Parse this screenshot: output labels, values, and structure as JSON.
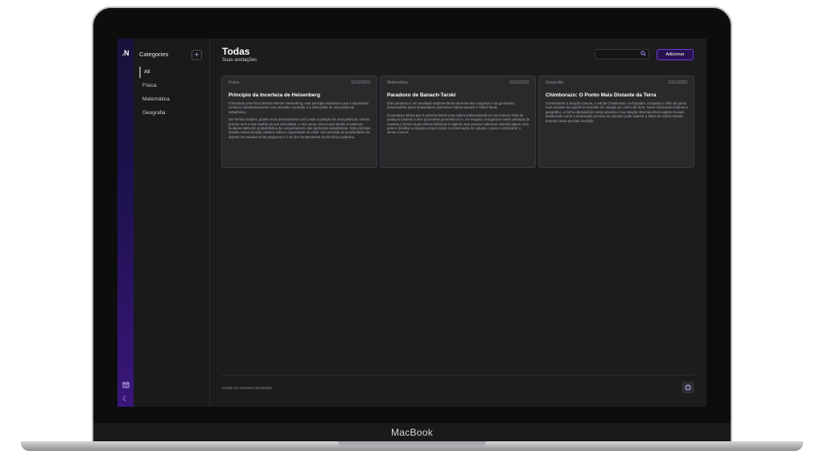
{
  "device": {
    "brand": "MacBook"
  },
  "app": {
    "logo": ".N"
  },
  "rail": {
    "icons": [
      "calendar-icon",
      "moon-icon"
    ]
  },
  "categories": {
    "title": "Categories",
    "add_label": "+",
    "items": [
      {
        "label": "All",
        "active": true
      },
      {
        "label": "Física",
        "active": false
      },
      {
        "label": "Matemática",
        "active": false
      },
      {
        "label": "Geografia",
        "active": false
      }
    ]
  },
  "header": {
    "title": "Todas",
    "subtitle": "Suas anotações",
    "search_placeholder": "",
    "add_button": "Adicionar"
  },
  "notes": [
    {
      "category": "Física",
      "date": "11/11/2023",
      "title": "Princípio da Incerteza de Heisenberg",
      "paragraphs": [
        "Formulado pelo físico alemão Werner Heisenberg, este princípio estabelece que é impossível conhecer simultaneamente com precisão a posição e a velocidade de uma partícula subatômica.",
        "Em termos simples, quanto mais precisamente você mede a posição de uma partícula, menos precisa será a sua medida da sua velocidade, e vice-versa. Isso ocorre devido à natureza fundamentalmente probabilística do comportamento das partículas subatômicas. Este princípio desafia nossa intuição clássica sobre a capacidade de medir com precisão as propriedades de objetos em escalas muito pequenas e é um dos fundamentos da mecânica quântica."
      ]
    },
    {
      "category": "Matemática",
      "date": "11/11/2023",
      "title": "Paradoxo de Banach-Tarski",
      "paragraphs": [
        "Este paradoxo é um resultado surpreendente da teoria dos conjuntos e da geometria, desenvolvido pelos matemáticos poloneses Stefan Banach e Alfred Tarski.",
        "O paradoxo afirma que é possível dividir uma esfera tridimensional em um número finito de pedaços (usando cortes puramente geométricos) e, em seguida, reorganizar esses pedaços de maneira a formar duas esferas idênticas à original, sem precisar adicionar material algum. Isso parece desafiar a intuição comum sobre a conservação de volume e parece contradizer o senso comum."
      ]
    },
    {
      "category": "Geografia",
      "date": "11/11/2023",
      "title": "Chimborazo: O Ponto Mais Distante da Terra",
      "paragraphs": [
        "Contrariando a intuição comum, o vulcão Chimborazo, no Equador, conquista o título de ponto mais distante da superfície terrestre em relação ao centro da Terra. Neste fascinante fenômeno geográfico, a forma elipsoidal do nosso planeta e sua rotação desempenham papéis cruciais, destacando como a localização próxima ao equador pode superar a altura do icônico Monte Everest nessa peculiar medição."
      ]
    }
  ],
  "footer": {
    "credit": "Criado por Gustavo Hernandes.",
    "icon": "github-icon"
  }
}
